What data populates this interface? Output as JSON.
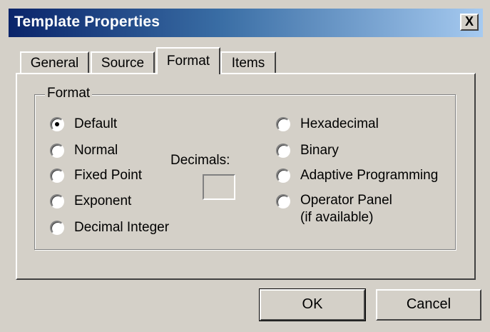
{
  "window": {
    "title": "Template Properties",
    "close_label": "X"
  },
  "tabs": [
    {
      "label": "General",
      "active": false
    },
    {
      "label": "Source",
      "active": false
    },
    {
      "label": "Format",
      "active": true
    },
    {
      "label": "Items",
      "active": false
    }
  ],
  "format_group": {
    "label": "Format",
    "left_options": [
      "Default",
      "Normal",
      "Fixed Point",
      "Exponent",
      "Decimal Integer"
    ],
    "right_options": [
      "Hexadecimal",
      "Binary",
      "Adaptive Programming"
    ],
    "operator_panel": {
      "line1": "Operator Panel",
      "line2": "(if available)"
    },
    "selected": "Default",
    "decimals_label": "Decimals:",
    "decimals_value": ""
  },
  "buttons": {
    "ok": "OK",
    "cancel": "Cancel"
  }
}
